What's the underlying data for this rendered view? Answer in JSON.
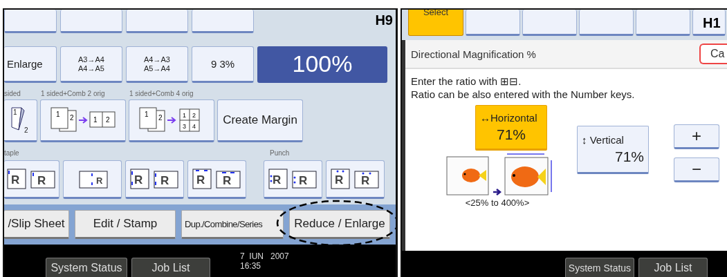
{
  "left_panel": {
    "label": "H9",
    "ratio_buttons": [
      {
        "lines": [
          "Enlarge"
        ],
        "selected": false
      },
      {
        "lines": [
          "A3→A4",
          "A4→A5"
        ],
        "selected": false
      },
      {
        "lines": [
          "A4→A3",
          "A5→A4"
        ],
        "selected": false
      },
      {
        "lines": [
          "9 3%"
        ],
        "selected": false
      },
      {
        "lines": [
          "100%"
        ],
        "selected": true
      }
    ],
    "combine_labels": [
      "sided",
      "1 sided+Comb 2 orig",
      "1 sided+Comb 4 orig"
    ],
    "combine_buttons": [
      {
        "kind": "duplex",
        "digits": [
          "1",
          "2"
        ]
      },
      {
        "kind": "combine",
        "originals": [
          "1",
          "2"
        ],
        "result": [
          "1",
          "2"
        ]
      },
      {
        "kind": "combine",
        "originals": [
          "1",
          "2"
        ],
        "result": [
          "1",
          "2",
          "3",
          "4"
        ]
      },
      {
        "kind": "text",
        "label": "Create Margin"
      }
    ],
    "staple_label": "taple",
    "punch_label": "Punch",
    "finish_buttons": [
      {
        "kind": "staple-corner",
        "letters": [
          "R",
          "R"
        ]
      },
      {
        "kind": "staple-side",
        "letters": [
          "R"
        ]
      },
      {
        "kind": "staple-left",
        "letters": [
          "R",
          "R"
        ]
      },
      {
        "kind": "staple-top",
        "letters": [
          "R",
          "R"
        ]
      },
      {
        "kind": "punch-left",
        "letters": [
          "R",
          "R"
        ]
      },
      {
        "kind": "punch-top",
        "letters": [
          "R",
          "R"
        ]
      }
    ],
    "tabs": [
      {
        "label": "/Slip Sheet",
        "selected": false
      },
      {
        "label": "Edit / Stamp",
        "selected": false
      },
      {
        "label": "Dup./Combine/Series",
        "selected": false
      },
      {
        "label": "Reduce / Enlarge",
        "selected": false
      }
    ],
    "status_buttons": [
      "System Status",
      "Job List"
    ],
    "date": "7  IUN   2007",
    "time": "16:35"
  },
  "right_panel": {
    "label": "H1",
    "select_button": {
      "label": "Select",
      "selected": true
    },
    "dialog_title": "Directional Magnification %",
    "cancel_button": "Ca",
    "instructions": [
      "Enter the ratio with ⊞⊟.",
      "Ratio can be also entered with the Number keys."
    ],
    "directions": [
      {
        "kind": "horizontal",
        "icon": "↔",
        "label": "Horizontal",
        "value": "71%",
        "selected": true
      },
      {
        "kind": "vertical",
        "icon": "↕",
        "label": "Vertical",
        "value": "71%",
        "selected": false
      }
    ],
    "range": "<25% to 400%>",
    "step_buttons": [
      "+",
      "−"
    ],
    "status_buttons": [
      "System Status",
      "Job List"
    ]
  }
}
